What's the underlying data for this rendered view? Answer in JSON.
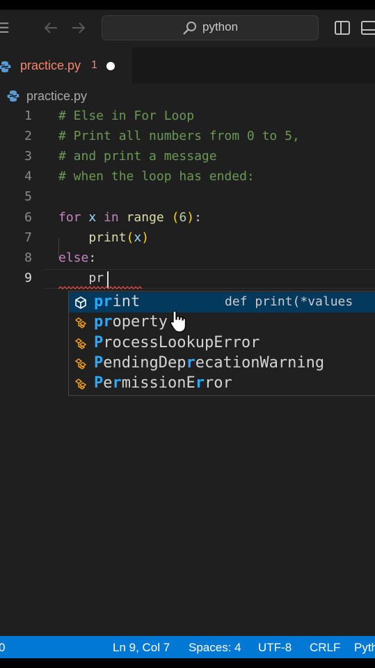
{
  "title_bar": {
    "search_text": "python"
  },
  "tab": {
    "label": "practice.py",
    "problem_count": "1"
  },
  "breadcrumb": {
    "file": "practice.py"
  },
  "editor": {
    "lines": [
      {
        "number": "1",
        "text": "# Else in For Loop"
      },
      {
        "number": "2",
        "text": "# Print all numbers from 0 to 5,"
      },
      {
        "number": "3",
        "text": "# and print a message"
      },
      {
        "number": "4",
        "text": "# when the loop has ended:"
      },
      {
        "number": "5",
        "text": ""
      },
      {
        "number": "6",
        "text": "for x in range (6):"
      },
      {
        "number": "7",
        "text": "    print(x)"
      },
      {
        "number": "8",
        "text": "else:"
      },
      {
        "number": "9",
        "text": "    pr"
      }
    ],
    "tokens": {
      "l6_for": "for",
      "l6_x": "x",
      "l6_in": "in",
      "l6_range": "range",
      "l6_open": "(",
      "l6_num": "6",
      "l6_close": ")",
      "l6_colon": ":",
      "l7_print": "print",
      "l7_open": "(",
      "l7_x": "x",
      "l7_close": ")",
      "l8_else": "else",
      "l8_colon": ":",
      "l9_typed": "pr"
    }
  },
  "suggestions": [
    {
      "match": "pr",
      "rest": "int",
      "detail": "def print(*values",
      "kind": "function-cube-icon",
      "selected": true
    },
    {
      "match": "pr",
      "rest": "operty",
      "detail": "",
      "kind": "class-icon",
      "selected": false
    },
    {
      "match": "P",
      "rest": "rocessLookupError",
      "detail": "",
      "kind": "class-icon",
      "selected": false
    },
    {
      "match": "P",
      "rest": "endingDep",
      "match2": "r",
      "rest2": "ecationWarning",
      "detail": "",
      "kind": "class-icon",
      "selected": false
    },
    {
      "match": "P",
      "rest": "e",
      "match2": "r",
      "rest2": "missionE",
      "match3": "r",
      "rest3": "ror",
      "detail": "",
      "kind": "class-icon",
      "selected": false
    }
  ],
  "status_bar": {
    "left_count": "0",
    "position": "Ln 9, Col 7",
    "spaces": "Spaces: 4",
    "encoding": "UTF-8",
    "eol": "CRLF",
    "language": "Pyth"
  },
  "colors": {
    "accent": "#0078d4",
    "error": "#f48771",
    "comment": "#6a9955",
    "keyword": "#c586c0",
    "function": "#dcdcaa",
    "match_highlight": "#2aaaff"
  }
}
